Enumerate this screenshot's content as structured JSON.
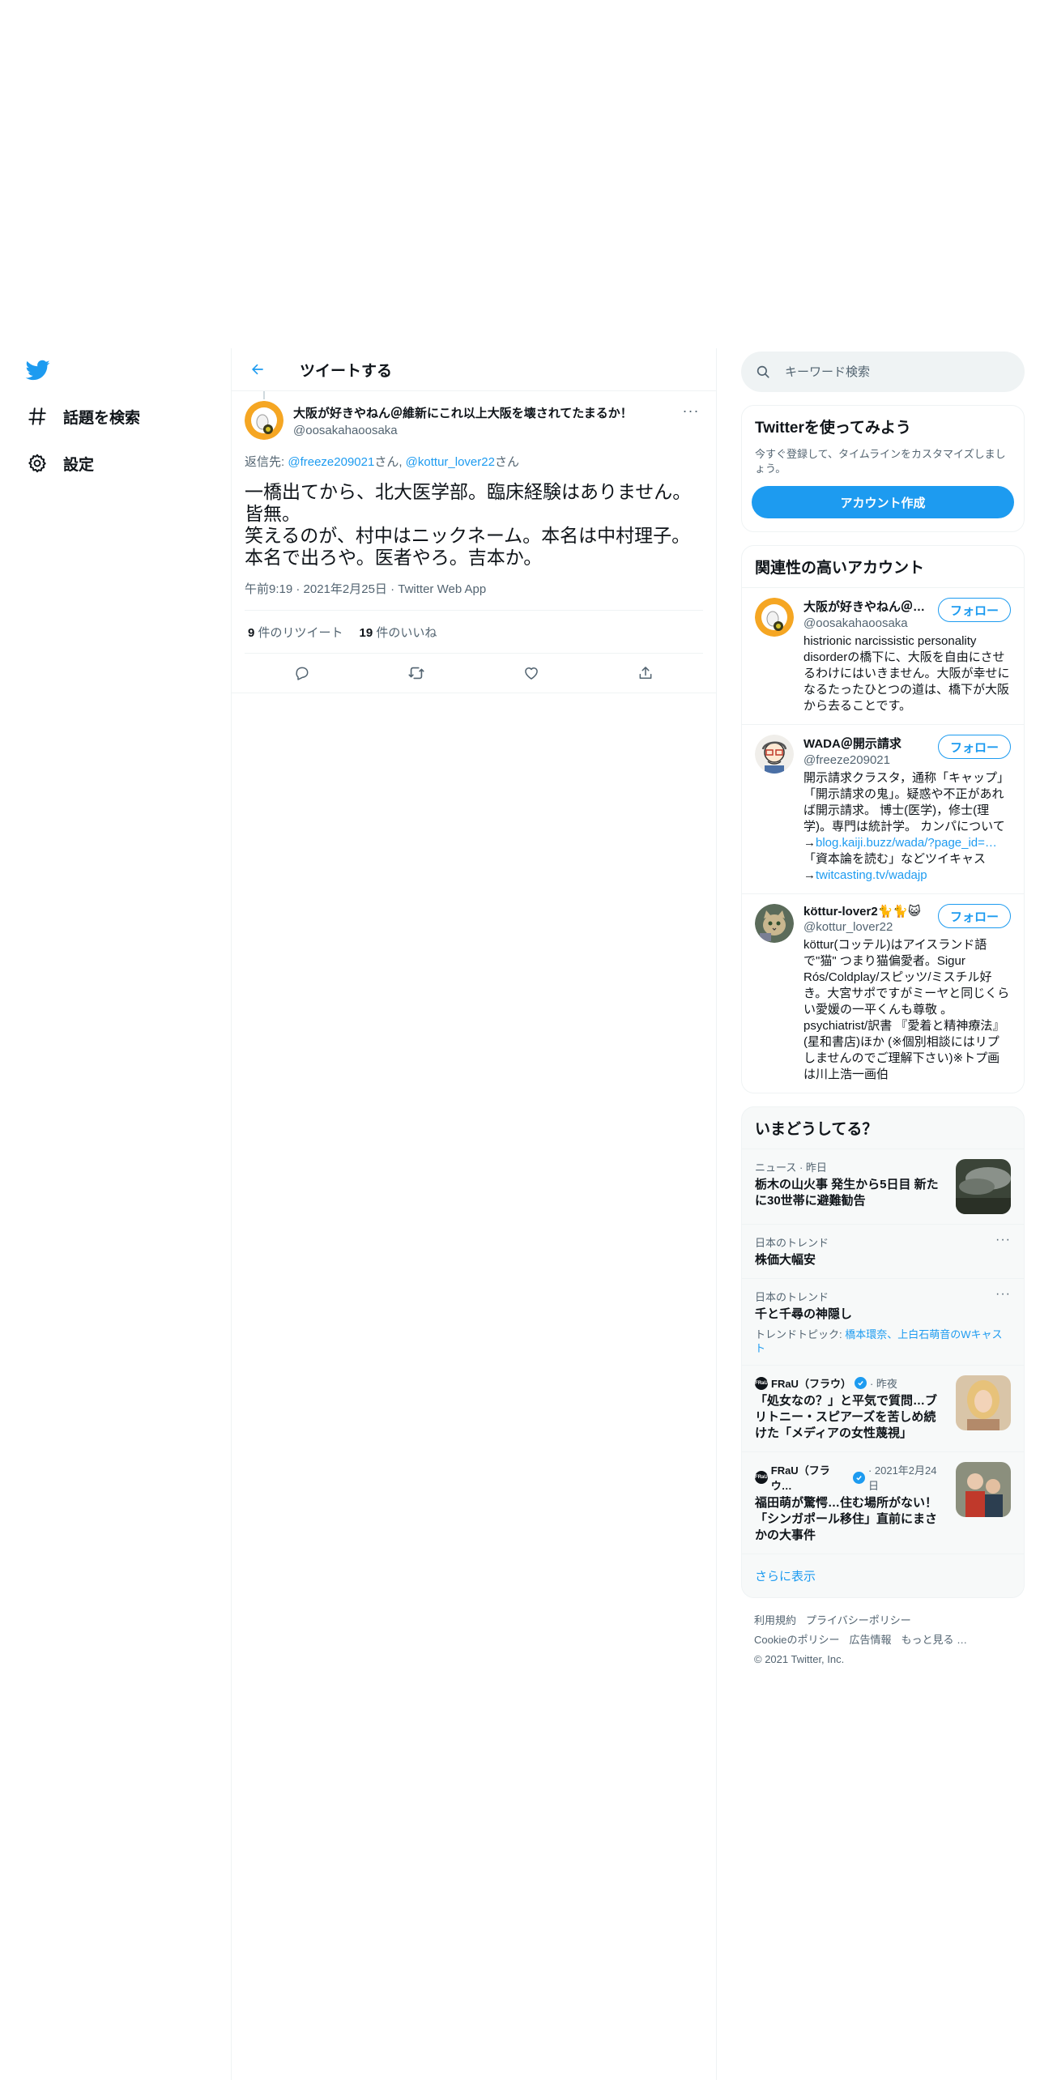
{
  "nav": {
    "logo": "twitter-logo",
    "items": [
      {
        "label": "話題を検索",
        "icon": "hashtag-icon"
      },
      {
        "label": "設定",
        "icon": "gear-icon"
      }
    ]
  },
  "header": {
    "title": "ツイートする"
  },
  "tweet": {
    "author_name": "大阪が好きやねん＠維新にこれ以上大阪を壊されてたまるか！",
    "author_handle": "@oosakahaoosaka",
    "more": "···",
    "reply_prefix": "返信先: ",
    "reply_user1": "@freeze209021",
    "reply_san1": "さん, ",
    "reply_user2": "@kottur_lover22",
    "reply_san2": "さん",
    "text_lines": [
      "一橋出てから、北大医学部。臨床経験はありません。皆無。",
      "笑えるのが、村中はニックネーム。本名は中村理子。本名で出ろや。医者やろ。吉本か。"
    ],
    "meta": "午前9:19 · 2021年2月25日 · Twitter Web App",
    "retweets_count": "9",
    "retweets_label": " 件のリツイート",
    "likes_count": "19",
    "likes_label": " 件のいいね"
  },
  "search": {
    "placeholder": "キーワード検索"
  },
  "signup": {
    "title": "Twitterを使ってみよう",
    "subtitle": "今すぐ登録して、タイムラインをカスタマイズしましょう。",
    "button": "アカウント作成"
  },
  "related": {
    "title": "関連性の高いアカウント",
    "follow_label": "フォロー",
    "accounts": [
      {
        "name": "大阪が好きやねん＠維新にこれ以上大阪を壊されてたまるか！",
        "handle": "@oosakahaoosaka",
        "bio": "histrionic narcissistic personality disorderの橋下に、大阪を自由にさせるわけにはいきません。大阪が幸せになるたったひとつの道は、橋下が大阪から去ることです。"
      },
      {
        "name": "WADA＠開示請求",
        "handle": "@freeze209021",
        "bio": "開示請求クラスタ，通称「キャップ」「開示請求の鬼」。疑惑や不正があれば開示請求。 博士(医学)，修士(理学)。専門は統計学。 カンパについて→",
        "link1": "blog.kaiji.buzz/wada/?page_id=…",
        "bio2": "「資本論を読む」などツイキャス→",
        "link2": "twitcasting.tv/wadajp"
      },
      {
        "name": "köttur-lover2🐈🐈😺",
        "handle": "@kottur_lover22",
        "bio": "köttur(コッテル)はアイスランド語で\"猫\" つまり猫偏愛者。Sigur Rós/Coldplay/スピッツ/ミスチル好き。大宮サポですがミーヤと同じくらい愛媛の一平くんも尊敬 。psychiatrist/訳書 『愛着と精神療法』(星和書店)ほか (※個別相談にはリプしませんのでご理解下さい)※トプ画は川上浩一画伯"
      }
    ]
  },
  "trends": {
    "title": "いまどうしてる？",
    "items": [
      {
        "context": "ニュース · 昨日",
        "title": "栃木の山火事 発生から5日目 新たに30世帯に避難勧告",
        "thumb": "smoke-photo"
      },
      {
        "context": "日本のトレンド",
        "title": "株価大幅安"
      },
      {
        "context": "日本のトレンド",
        "title": "千と千尋の神隠し",
        "sub_prefix": "トレンドトピック: ",
        "sub_link": "橋本環奈、上白石萌音のWキャスト"
      },
      {
        "source": "FRaU（フラウ）",
        "time": " · 昨夜",
        "title": "「処女なの？」と平気で質問…ブリトニー・スピアーズを苦しめ続けた「メディアの女性蔑視」",
        "thumb": "portrait-photo"
      },
      {
        "source": "FRaU（フラウ…",
        "time": " · 2021年2月24日",
        "title": "福田萌が驚愕…住む場所がない！「シンガポール移住」直前にまさかの大事件",
        "thumb": "family-photo"
      }
    ],
    "more": "さらに表示",
    "more_icon": "···"
  },
  "footer": {
    "links": [
      "利用規約",
      "プライバシーポリシー",
      "Cookieのポリシー",
      "広告情報",
      "もっと見る …"
    ],
    "copyright": "© 2021 Twitter, Inc."
  },
  "colors": {
    "accent": "#1d9bf0",
    "muted": "#536471",
    "text": "#0f1419",
    "border": "#eff3f4"
  }
}
